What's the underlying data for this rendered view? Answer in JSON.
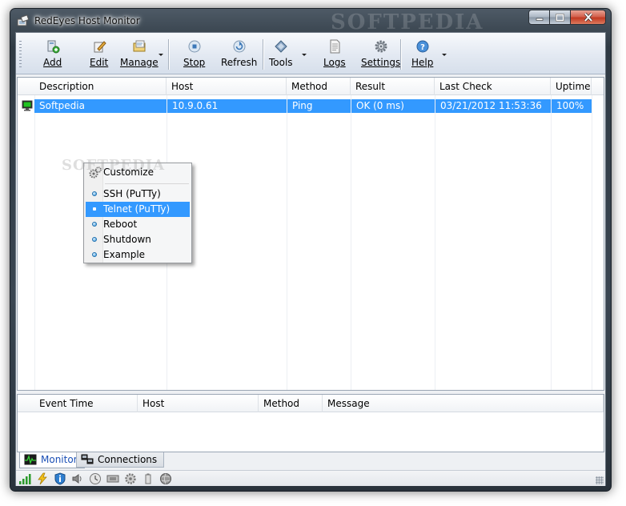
{
  "window": {
    "title": "RedEyes Host Monitor",
    "watermark": "SOFTPEDIA"
  },
  "toolbar": {
    "add": "Add",
    "edit": "Edit",
    "manage": "Manage",
    "stop": "Stop",
    "refresh": "Refresh",
    "tools": "Tools",
    "logs": "Logs",
    "settings": "Settings",
    "help": "Help"
  },
  "hosts": {
    "columns": [
      "Description",
      "Host",
      "Method",
      "Result",
      "Last Check",
      "Uptime"
    ],
    "rows": [
      {
        "description": "Softpedia",
        "host": "10.9.0.61",
        "method": "Ping",
        "result": "OK (0 ms)",
        "last_check": "03/21/2012 11:53:36",
        "uptime": "100%"
      }
    ]
  },
  "context_menu": {
    "items": [
      "Customize",
      "SSH (PuTTy)",
      "Telnet (PuTTy)",
      "Reboot",
      "Shutdown",
      "Example"
    ],
    "selected": "Telnet (PuTTy)",
    "watermark": "SOFTPEDIA"
  },
  "events": {
    "columns": [
      "Event Time",
      "Host",
      "Method",
      "Message"
    ]
  },
  "tabs": {
    "monitor": "Monitor",
    "connections": "Connections"
  },
  "colors": {
    "selection": "#3399ff",
    "active_tab_text": "#1a4fb5"
  }
}
